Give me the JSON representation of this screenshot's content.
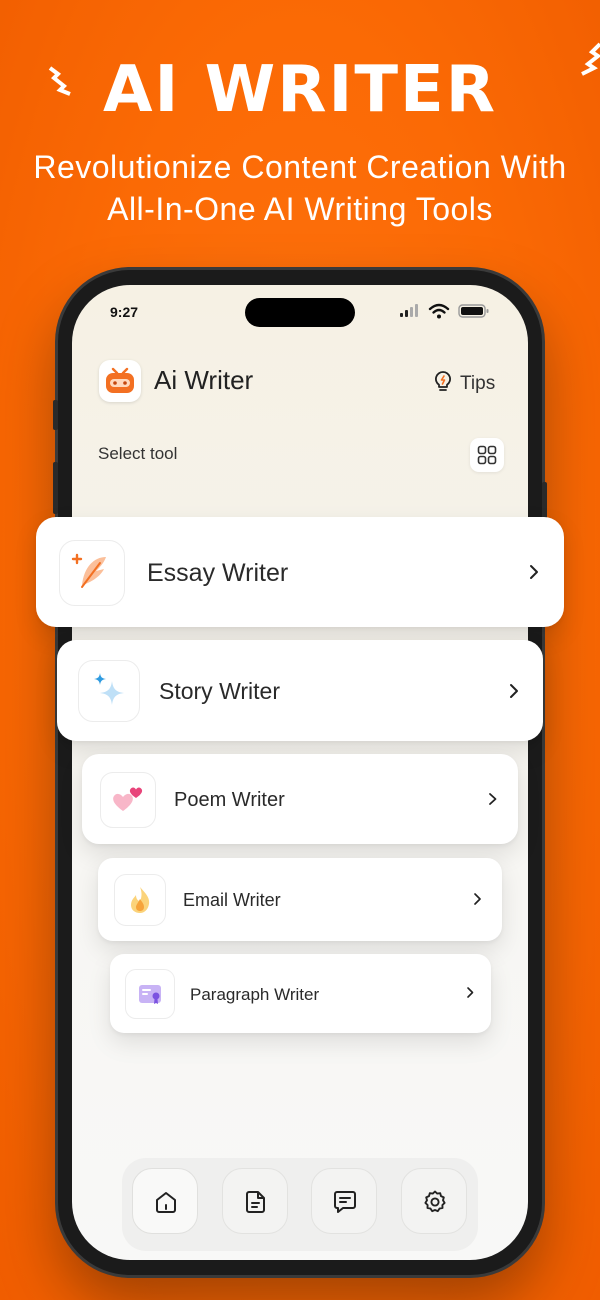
{
  "promo": {
    "headline": "AI WRITER",
    "subline_1": "Revolutionize Content Creation With",
    "subline_2": "All-In-One AI Writing Tools"
  },
  "status_bar": {
    "time": "9:27"
  },
  "app": {
    "title": "Ai Writer",
    "tips_label": "Tips",
    "section_label": "Select tool"
  },
  "tools": [
    {
      "label": "Essay Writer",
      "icon": "feather-pen-icon"
    },
    {
      "label": "Story Writer",
      "icon": "sparkle-icon"
    },
    {
      "label": "Poem Writer",
      "icon": "hearts-icon"
    },
    {
      "label": "Email Writer",
      "icon": "fire-icon"
    },
    {
      "label": "Paragraph Writer",
      "icon": "certificate-icon"
    }
  ],
  "bottom_nav": [
    {
      "name": "home-icon",
      "active": true
    },
    {
      "name": "document-icon",
      "active": false
    },
    {
      "name": "chat-icon",
      "active": false
    },
    {
      "name": "settings-icon",
      "active": false
    }
  ],
  "colors": {
    "background": "#fb6a05",
    "accent": "#f26a1b",
    "text": "#2a2a2a"
  }
}
